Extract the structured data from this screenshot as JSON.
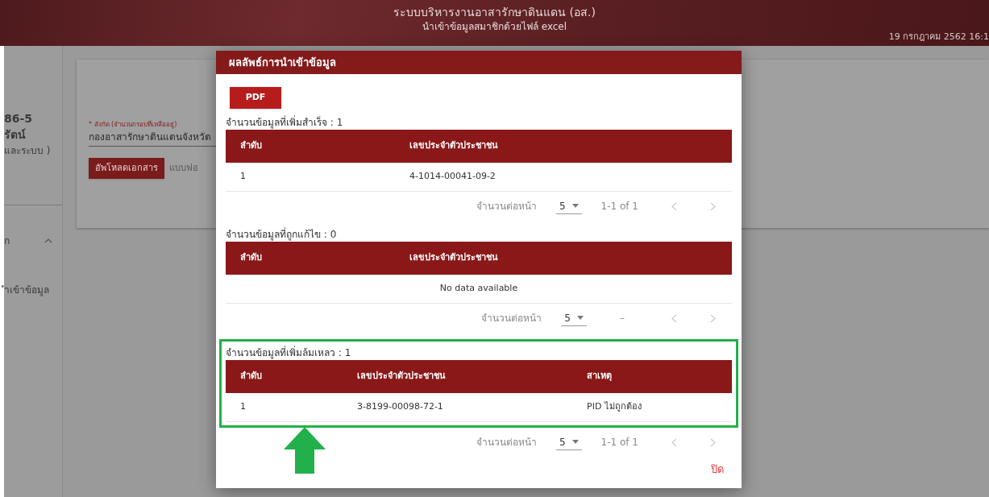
{
  "header": {
    "title": "ระบบบริหารงานอาสารักษาดินแดน (อส.)",
    "subtitle": "นำเข้าข้อมูลสมาชิกด้วยไฟล์ excel",
    "datetime": "19 กรกฎาคม 2562 16:1"
  },
  "sidebar": {
    "lines": [
      "86-5",
      "รัตน์",
      "และระบบ )"
    ],
    "menu": {
      "label": "ก",
      "expanded": true
    },
    "item": "ำเข้าข้อมูล"
  },
  "form": {
    "field_label": "* สังกัด (จำนวนกรอบที่เหลืออยู่)",
    "field_value": "กองอาสารักษาดินแดนจังหวัด",
    "upload_button": "อัพโหลดเอกสาร",
    "template_link": "แบบฟอ"
  },
  "dialog": {
    "title": "ผลลัพธ์การนำเข้าข้อมูล",
    "pdf_button": "PDF",
    "close_button": "ปิด",
    "sections": [
      {
        "title": "จำนวนข้อมูลที่เพิ่มสำเร็จ : 1",
        "highlighted": false,
        "columns": [
          "ลำดับ",
          "เลขประจำตัวประชาชน"
        ],
        "rows": [
          [
            "1",
            "4-1014-00041-09-2"
          ]
        ],
        "pagination": {
          "per_page_label": "จำนวนต่อหน้า",
          "per_page": "5",
          "range": "1-1 of 1"
        }
      },
      {
        "title": "จำนวนข้อมูลที่ถูกแก้ไข : 0",
        "highlighted": false,
        "columns": [
          "ลำดับ",
          "เลขประจำตัวประชาชน"
        ],
        "empty_text": "No data available",
        "pagination": {
          "per_page_label": "จำนวนต่อหน้า",
          "per_page": "5",
          "range": "–"
        }
      },
      {
        "title": "จำนวนข้อมูลที่เพิ่มล้มเหลว : 1",
        "highlighted": true,
        "columns": [
          "ลำดับ",
          "เลขประจำตัวประชาชน",
          "สาเหตุ"
        ],
        "rows": [
          [
            "1",
            "3-8199-00098-72-1",
            "PID ไม่ถูกต้อง"
          ]
        ],
        "pagination": {
          "per_page_label": "จำนวนต่อหน้า",
          "per_page": "5",
          "range": "1-1 of 1"
        }
      }
    ]
  }
}
